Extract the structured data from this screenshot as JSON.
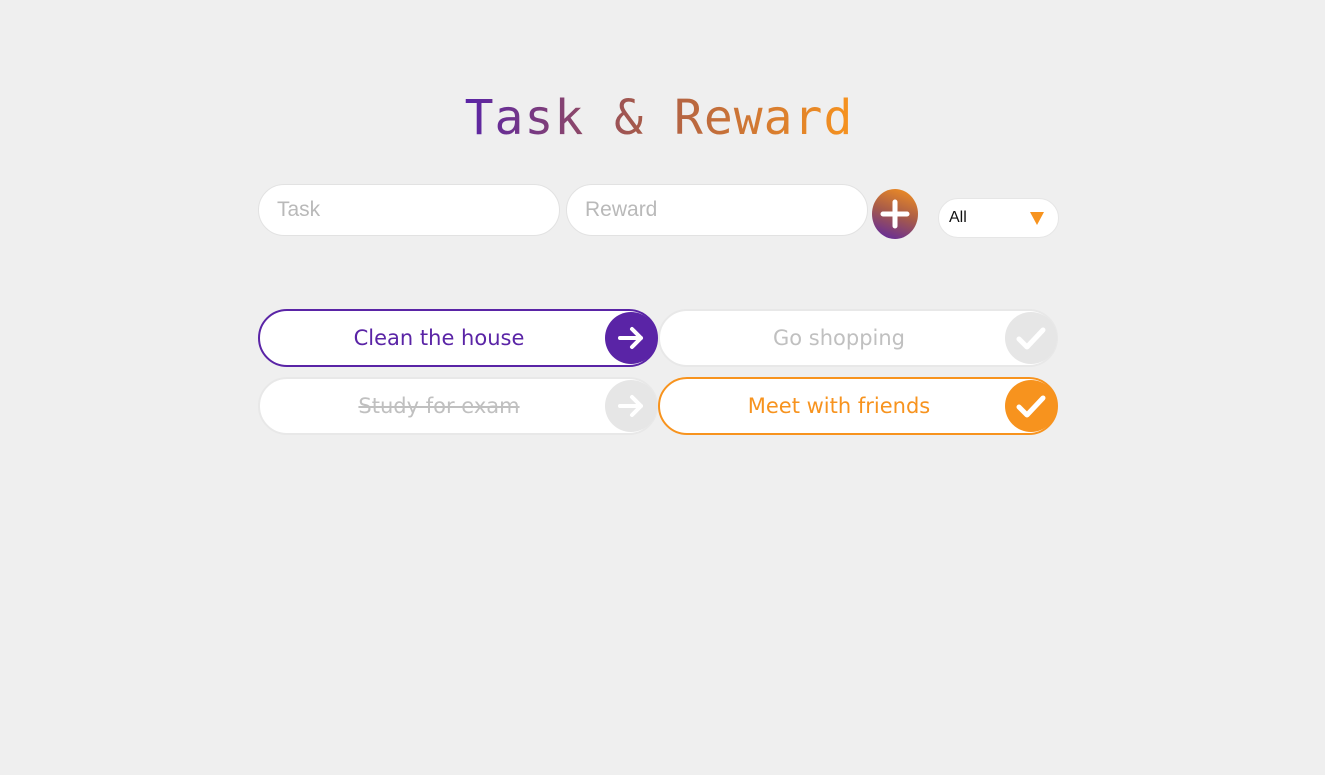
{
  "header": {
    "title": "Task & Reward"
  },
  "form": {
    "task_placeholder": "Task",
    "reward_placeholder": "Reward",
    "add_icon": "plus-icon",
    "filter": {
      "selected": "All",
      "caret_icon": "triangle-down-icon"
    }
  },
  "tasks": [
    {
      "label": "Clean the house",
      "state": "active",
      "action_icon": "arrow-right-icon"
    },
    {
      "label": "Go shopping",
      "state": "inactive",
      "action_icon": "check-icon"
    },
    {
      "label": "Study for exam",
      "state": "completed-struck",
      "action_icon": "arrow-right-icon"
    },
    {
      "label": "Meet with friends",
      "state": "reward-active",
      "action_icon": "check-icon"
    }
  ],
  "colors": {
    "purple": "#5a24a6",
    "orange": "#f7931e",
    "inactive_text": "#c0c0c0",
    "inactive_button": "#e6e6e6",
    "background": "#efefef"
  }
}
